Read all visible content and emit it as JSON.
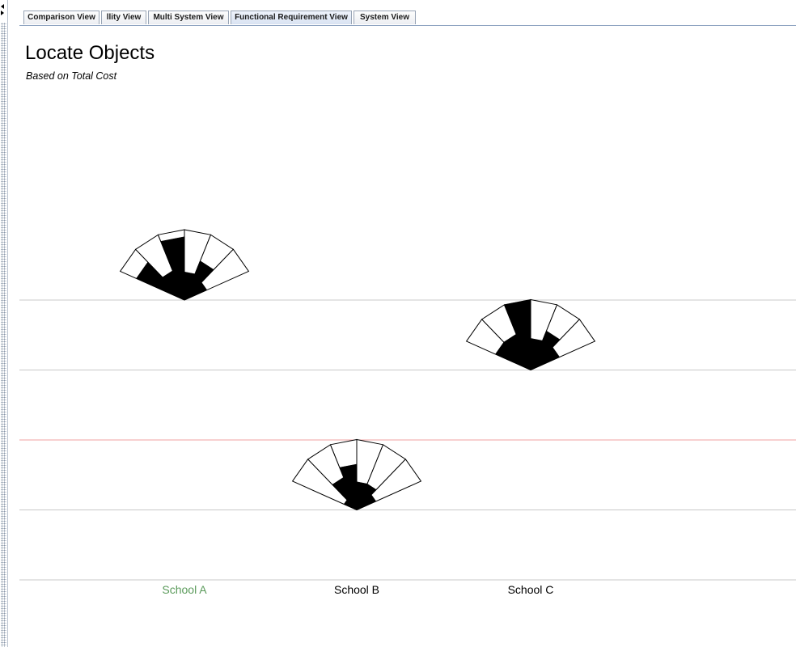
{
  "tabs": [
    {
      "label": "Comparison View",
      "active": false
    },
    {
      "label": "llity View",
      "active": false
    },
    {
      "label": "Multi System View",
      "active": false
    },
    {
      "label": "Functional Requirement View",
      "active": true
    },
    {
      "label": "System View",
      "active": false
    }
  ],
  "view": {
    "title": "Locate Objects",
    "subtitle": "Based on Total Cost"
  },
  "colors": {
    "gridline": "#c8c8c8",
    "highlight_line": "#f0a0a0",
    "selected_label": "#5a9a5a",
    "label": "#000000",
    "fill": "#000000"
  },
  "chart_data": {
    "type": "scatter",
    "x_categories": [
      "School A",
      "School B",
      "School C"
    ],
    "selected_category": "School A",
    "rows": 5,
    "highlighted_row_boundary": 2,
    "glyphs": [
      {
        "category": "School A",
        "row": 4,
        "segments": [
          0.75,
          0.45,
          0.9,
          0.4,
          0.6,
          0.35
        ]
      },
      {
        "category": "School C",
        "row": 3,
        "segments": [
          0.55,
          0.55,
          1.0,
          0.45,
          0.6,
          0.45
        ]
      },
      {
        "category": "School B",
        "row": 1,
        "segments": [
          0.2,
          0.5,
          0.65,
          0.4,
          0.4,
          0.3
        ]
      }
    ]
  }
}
